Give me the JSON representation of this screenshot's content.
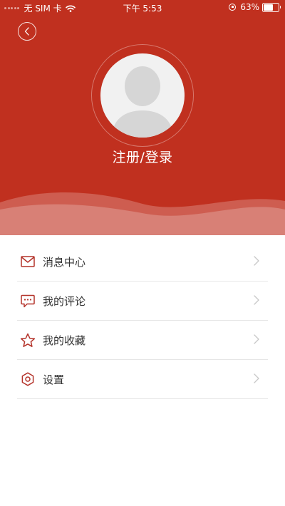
{
  "status_bar": {
    "carrier": "无 SIM 卡",
    "time": "下午 5:53",
    "battery_percent": "63%",
    "battery_level": 0.63
  },
  "header": {
    "login_label": "注册/登录"
  },
  "menu": {
    "items": [
      {
        "label": "消息中心",
        "icon": "mail-icon"
      },
      {
        "label": "我的评论",
        "icon": "comment-icon"
      },
      {
        "label": "我的收藏",
        "icon": "star-icon"
      },
      {
        "label": "设置",
        "icon": "gear-icon"
      }
    ]
  },
  "colors": {
    "brand_red": "#c0301f",
    "icon_red": "#b4332a",
    "divider": "#e6e6e6"
  }
}
